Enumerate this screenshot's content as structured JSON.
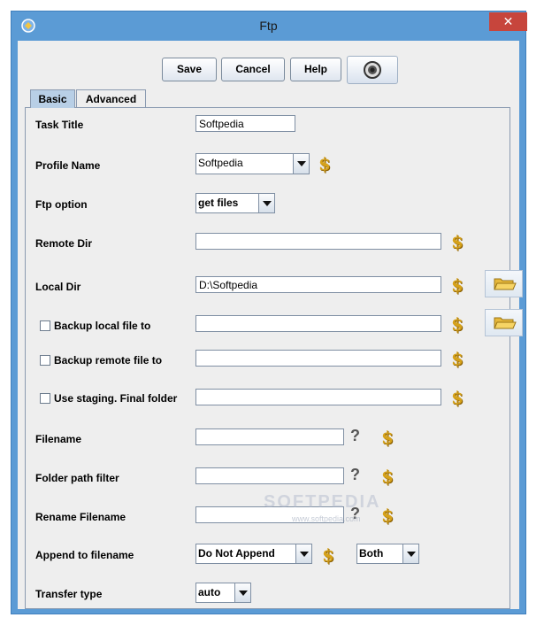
{
  "window": {
    "title": "Ftp",
    "close_label": "✕"
  },
  "toolbar": {
    "save_label": "Save",
    "cancel_label": "Cancel",
    "help_label": "Help"
  },
  "tabs": [
    {
      "label": "Basic",
      "active": true
    },
    {
      "label": "Advanced",
      "active": false
    }
  ],
  "form": {
    "task_title": {
      "label": "Task Title",
      "value": "Softpedia"
    },
    "profile_name": {
      "label": "Profile Name",
      "value": "Softpedia"
    },
    "ftp_option": {
      "label": "Ftp option",
      "value": "get files"
    },
    "remote_dir": {
      "label": "Remote Dir",
      "value": ""
    },
    "local_dir": {
      "label": "Local Dir",
      "value": "D:\\Softpedia"
    },
    "backup_local": {
      "label": "Backup local file to",
      "checked": false,
      "value": ""
    },
    "backup_remote": {
      "label": "Backup remote file to",
      "checked": false,
      "value": ""
    },
    "use_staging": {
      "label": "Use staging.  Final folder",
      "checked": false,
      "value": ""
    },
    "filename": {
      "label": "Filename",
      "value": ""
    },
    "folder_path_filter": {
      "label": "Folder path filter",
      "value": ""
    },
    "rename_filename": {
      "label": "Rename Filename",
      "value": ""
    },
    "append_to_filename": {
      "label": "Append to filename",
      "value": "Do Not Append",
      "position": "Both"
    },
    "transfer_type": {
      "label": "Transfer type",
      "value": "auto"
    }
  },
  "glyphs": {
    "dollar": "$",
    "question": "?"
  },
  "watermark": {
    "main": "SOFTPEDIA",
    "sub": "www.softpedia.com"
  },
  "colors": {
    "title_bar": "#5b9bd5",
    "close_button": "#c7453c",
    "dollar_icon": "#d6a21a",
    "active_tab": "#b8cfe6"
  }
}
